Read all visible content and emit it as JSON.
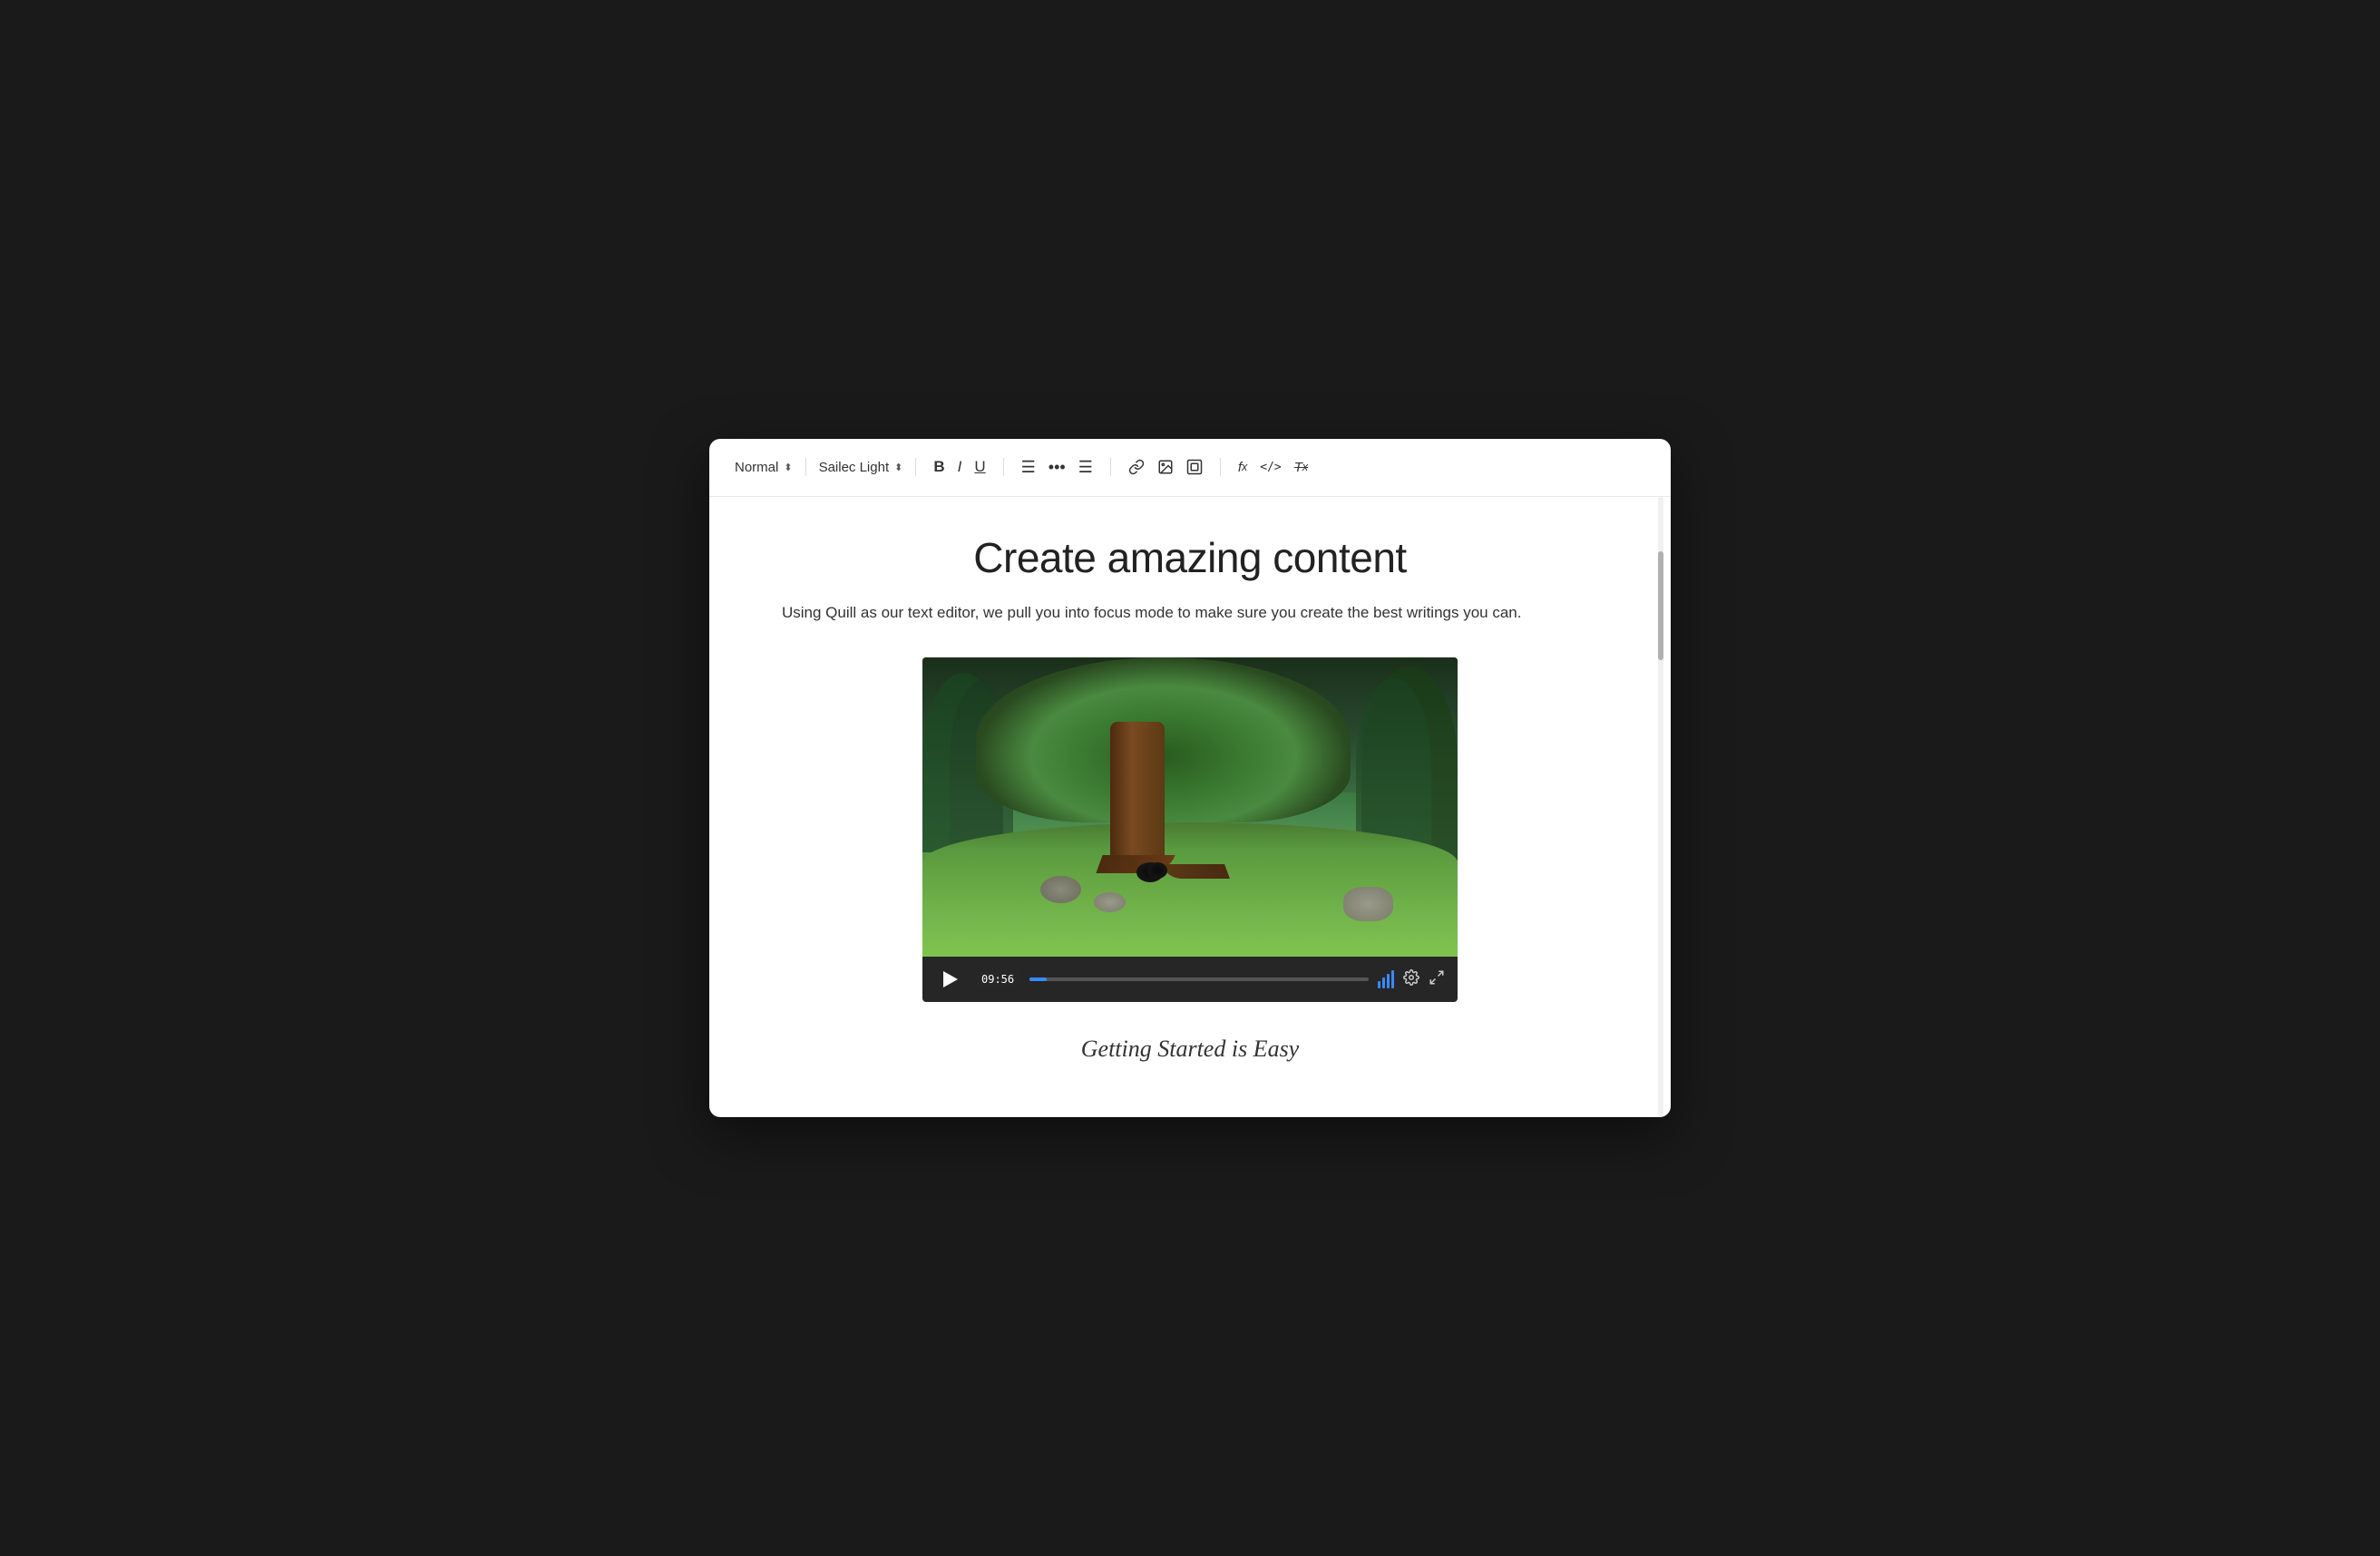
{
  "toolbar": {
    "style_select_label": "Normal",
    "style_select_chevron": "⬍",
    "font_select_label": "Sailec Light",
    "font_select_chevron": "⬍",
    "btn_bold": "B",
    "btn_italic": "I",
    "btn_underline": "U",
    "btn_ordered_list": "≡",
    "btn_unordered_list": "≡",
    "btn_align": "≡",
    "btn_link": "🔗",
    "btn_image": "🖼",
    "btn_video": "▣",
    "btn_formula": "fx",
    "btn_code": "</>",
    "btn_clear": "Tx"
  },
  "content": {
    "title": "Create amazing content",
    "subtitle": "Using Quill as our text editor, we pull you into focus mode to make sure you create the best writings you can.",
    "section_title": "Getting Started is Easy"
  },
  "video": {
    "timestamp": "09:56",
    "progress_percent": 5
  }
}
